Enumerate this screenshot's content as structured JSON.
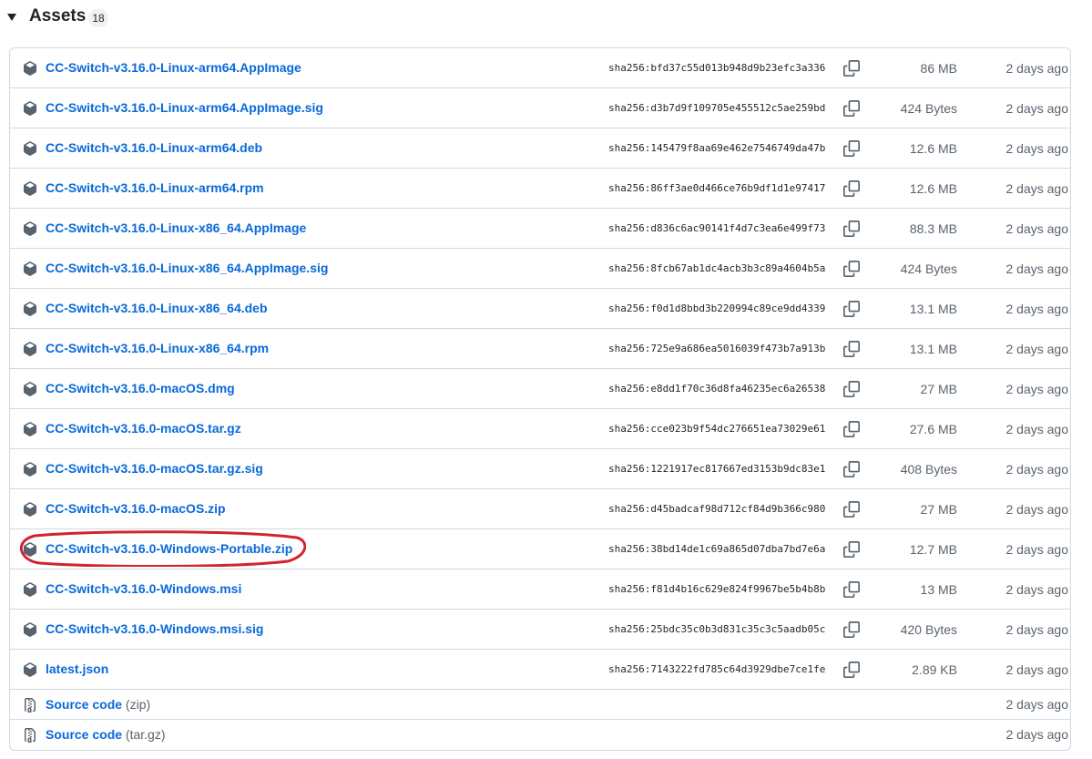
{
  "section": {
    "title": "Assets",
    "count": "18"
  },
  "assets": [
    {
      "name": "CC-Switch-v3.16.0-Linux-arm64.AppImage",
      "sha": "sha256:bfd37c55d013b948d9b23efc3a336",
      "size": "86 MB",
      "date": "2 days ago"
    },
    {
      "name": "CC-Switch-v3.16.0-Linux-arm64.AppImage.sig",
      "sha": "sha256:d3b7d9f109705e455512c5ae259bd",
      "size": "424 Bytes",
      "date": "2 days ago"
    },
    {
      "name": "CC-Switch-v3.16.0-Linux-arm64.deb",
      "sha": "sha256:145479f8aa69e462e7546749da47b",
      "size": "12.6 MB",
      "date": "2 days ago"
    },
    {
      "name": "CC-Switch-v3.16.0-Linux-arm64.rpm",
      "sha": "sha256:86ff3ae0d466ce76b9df1d1e97417",
      "size": "12.6 MB",
      "date": "2 days ago"
    },
    {
      "name": "CC-Switch-v3.16.0-Linux-x86_64.AppImage",
      "sha": "sha256:d836c6ac90141f4d7c3ea6e499f73",
      "size": "88.3 MB",
      "date": "2 days ago"
    },
    {
      "name": "CC-Switch-v3.16.0-Linux-x86_64.AppImage.sig",
      "sha": "sha256:8fcb67ab1dc4acb3b3c89a4604b5a",
      "size": "424 Bytes",
      "date": "2 days ago"
    },
    {
      "name": "CC-Switch-v3.16.0-Linux-x86_64.deb",
      "sha": "sha256:f0d1d8bbd3b220994c89ce9dd4339",
      "size": "13.1 MB",
      "date": "2 days ago"
    },
    {
      "name": "CC-Switch-v3.16.0-Linux-x86_64.rpm",
      "sha": "sha256:725e9a686ea5016039f473b7a913b",
      "size": "13.1 MB",
      "date": "2 days ago"
    },
    {
      "name": "CC-Switch-v3.16.0-macOS.dmg",
      "sha": "sha256:e8dd1f70c36d8fa46235ec6a26538",
      "size": "27 MB",
      "date": "2 days ago"
    },
    {
      "name": "CC-Switch-v3.16.0-macOS.tar.gz",
      "sha": "sha256:cce023b9f54dc276651ea73029e61",
      "size": "27.6 MB",
      "date": "2 days ago"
    },
    {
      "name": "CC-Switch-v3.16.0-macOS.tar.gz.sig",
      "sha": "sha256:1221917ec817667ed3153b9dc83e1",
      "size": "408 Bytes",
      "date": "2 days ago"
    },
    {
      "name": "CC-Switch-v3.16.0-macOS.zip",
      "sha": "sha256:d45badcaf98d712cf84d9b366c980",
      "size": "27 MB",
      "date": "2 days ago"
    },
    {
      "name": "CC-Switch-v3.16.0-Windows-Portable.zip",
      "sha": "sha256:38bd14de1c69a865d07dba7bd7e6a",
      "size": "12.7 MB",
      "date": "2 days ago"
    },
    {
      "name": "CC-Switch-v3.16.0-Windows.msi",
      "sha": "sha256:f81d4b16c629e824f9967be5b4b8b",
      "size": "13 MB",
      "date": "2 days ago"
    },
    {
      "name": "CC-Switch-v3.16.0-Windows.msi.sig",
      "sha": "sha256:25bdc35c0b3d831c35c3c5aadb05c",
      "size": "420 Bytes",
      "date": "2 days ago"
    },
    {
      "name": "latest.json",
      "sha": "sha256:7143222fd785c64d3929dbe7ce1fe",
      "size": "2.89 KB",
      "date": "2 days ago"
    }
  ],
  "source_code": [
    {
      "label": "Source code",
      "format": "(zip)",
      "date": "2 days ago"
    },
    {
      "label": "Source code",
      "format": "(tar.gz)",
      "date": "2 days ago"
    }
  ],
  "icons": {
    "asset": "package-icon",
    "source": "file-zip-icon",
    "copy": "copy-icon",
    "toggle": "triangle-down-icon"
  },
  "colors": {
    "link": "#0969da",
    "muted": "#59636e",
    "border": "#d1d9e0",
    "highlight": "#d1242f"
  }
}
